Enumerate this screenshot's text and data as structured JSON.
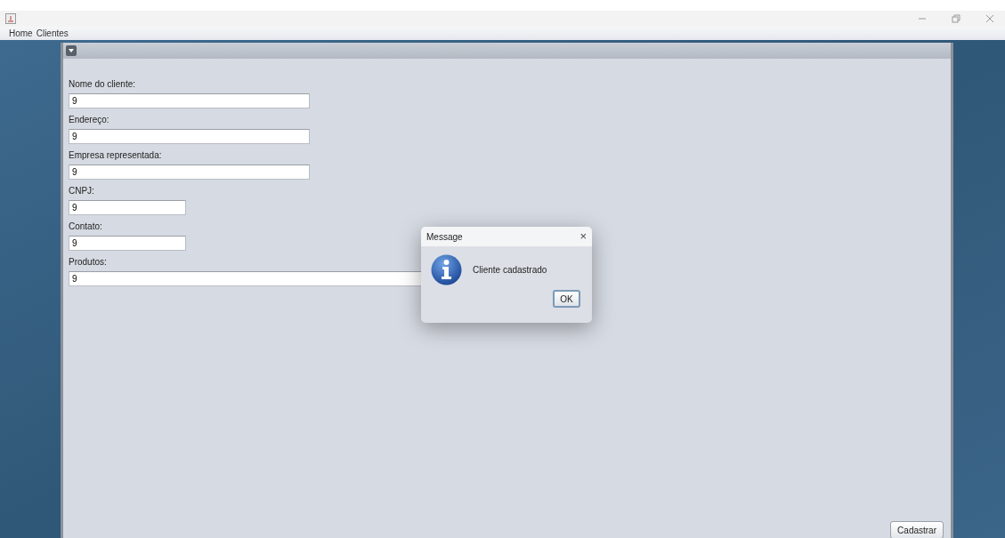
{
  "menu": [
    "Home",
    "Clientes"
  ],
  "form": {
    "fields": [
      {
        "label": "Nome do cliente:",
        "value": "9",
        "kind": "wide"
      },
      {
        "label": "Endereço:",
        "value": "9",
        "kind": "wide"
      },
      {
        "label": "Empresa representada:",
        "value": "9",
        "kind": "wide"
      },
      {
        "label": "CNPJ:",
        "value": "9",
        "kind": "short"
      },
      {
        "label": "Contato:",
        "value": "9",
        "kind": "short"
      },
      {
        "label": "Produtos:",
        "value": "9",
        "kind": "full"
      }
    ],
    "submit": "Cadastrar"
  },
  "dialog": {
    "title": "Message",
    "close": "×",
    "message": "Cliente cadastrado",
    "button": "OK"
  }
}
